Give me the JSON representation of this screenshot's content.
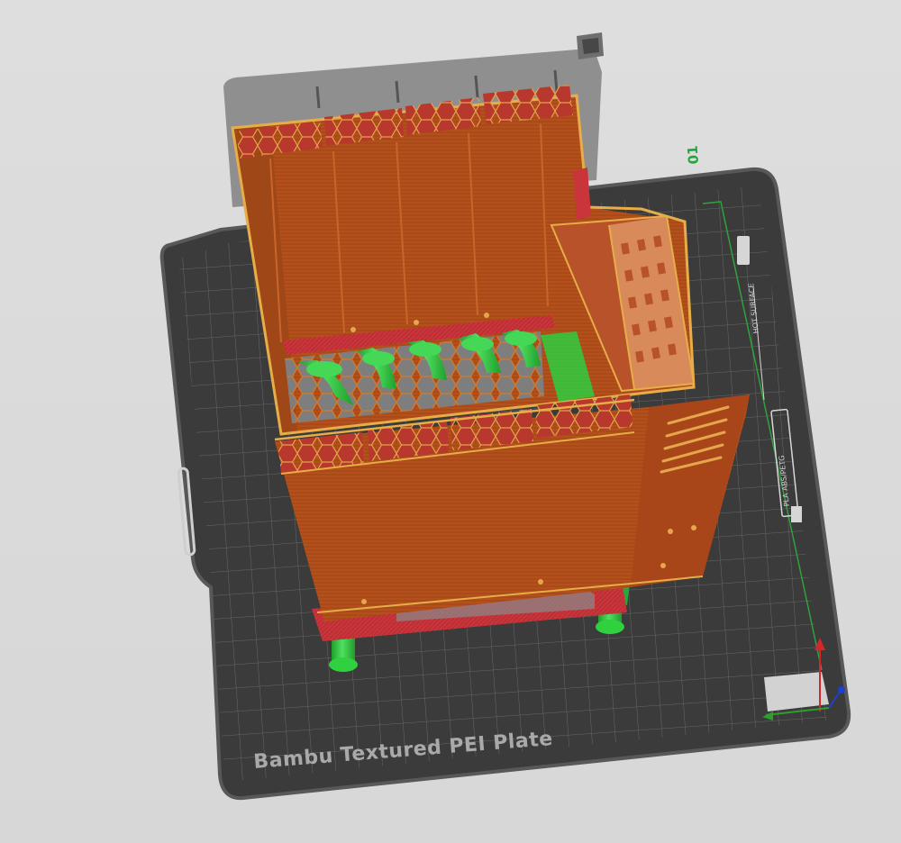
{
  "app": {
    "view": "3D slicer preview"
  },
  "plate": {
    "label": "Bambu Textured PEI Plate",
    "number": "01",
    "side_labels": [
      "PLA ABS/PETG",
      "HOT SURFACE"
    ]
  },
  "colors": {
    "background": "#dcdcdc",
    "plate": "#3d3d3d",
    "plate_edge": "#5a5a5a",
    "grid": "#6a6a6a",
    "back_plate": "#8c8c8c",
    "wall": "#b24f16",
    "wall_dark": "#8a3b10",
    "infill": "#c8323a",
    "support": "#2ecc40",
    "support_dark": "#1f9e2c",
    "perimeter": "#e8b04a",
    "axis_x": "#d62728",
    "axis_y": "#2ca02c",
    "axis_z": "#1f3fd0"
  },
  "icons": [
    "axis-gizmo-icon",
    "plate-handle-icon"
  ]
}
